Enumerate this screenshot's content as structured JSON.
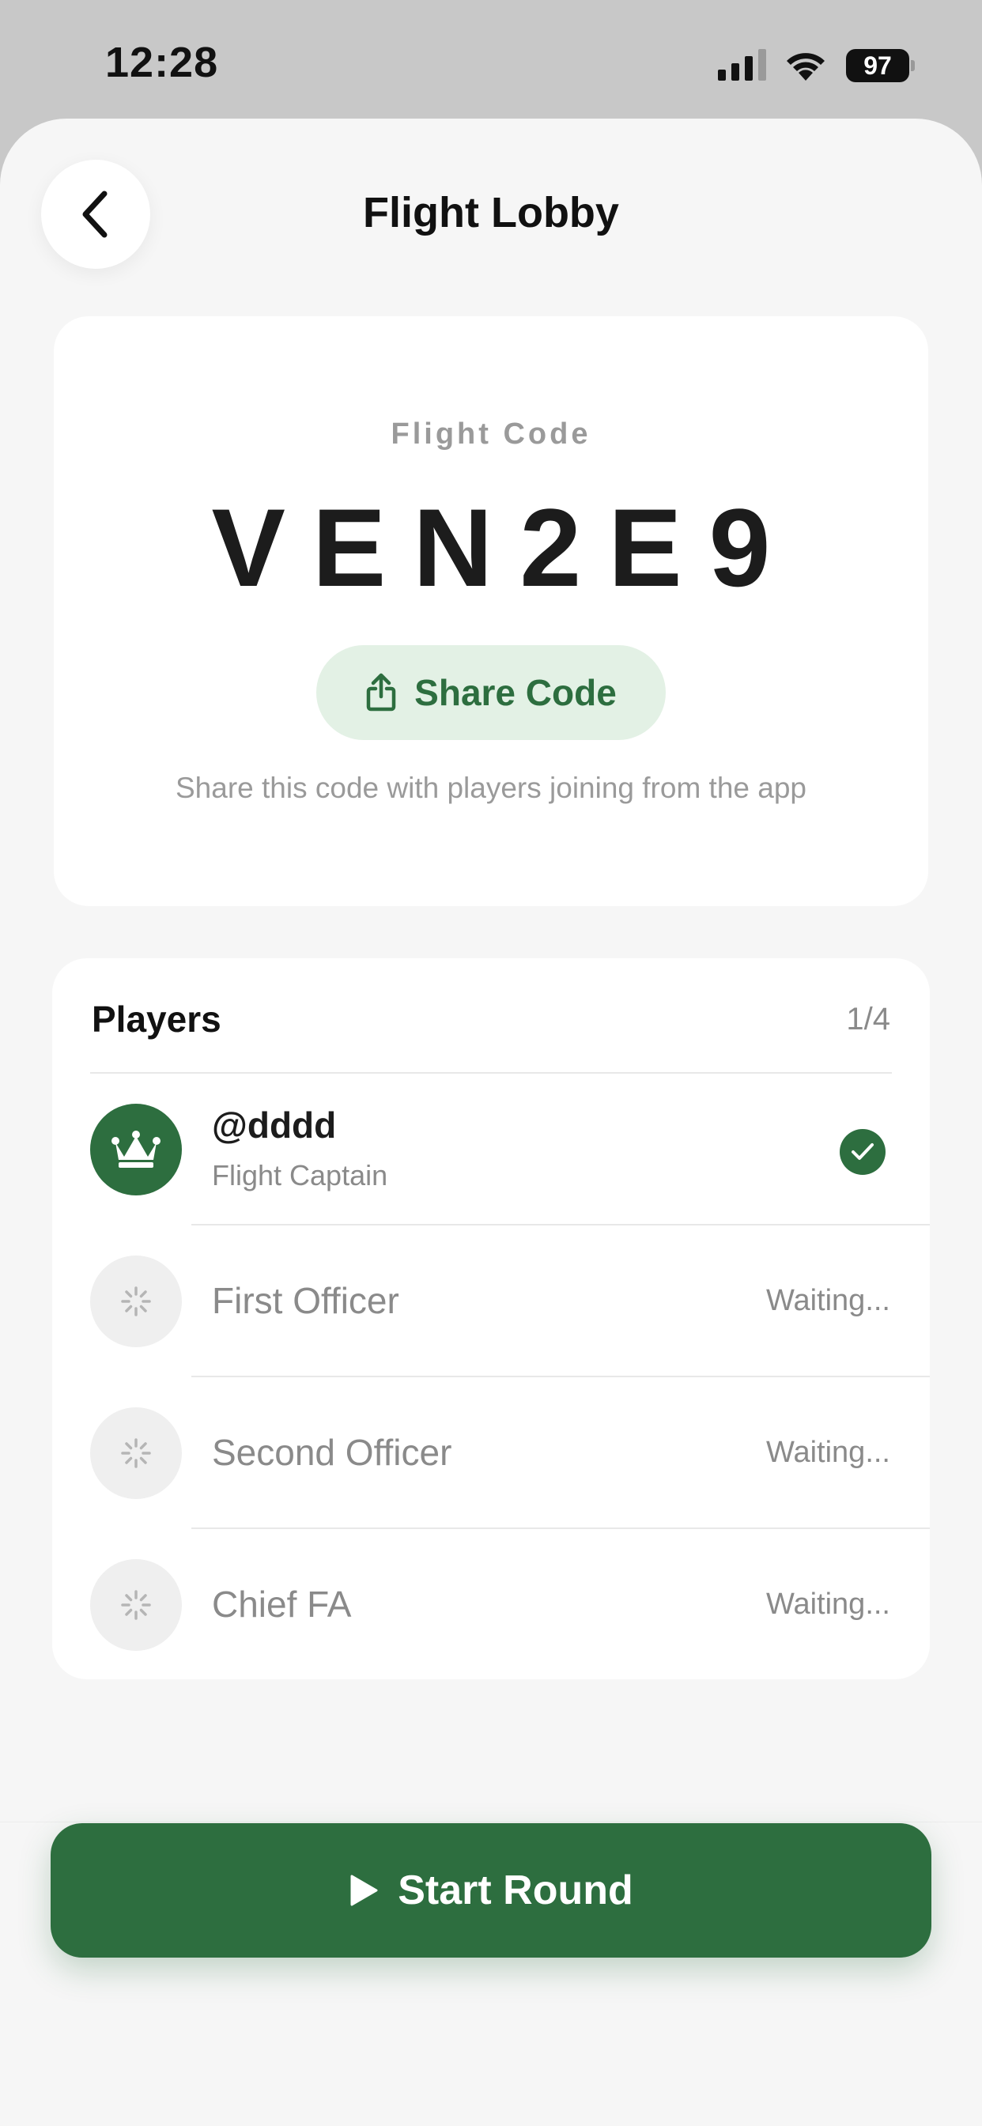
{
  "status_bar": {
    "time": "12:28",
    "battery": "97"
  },
  "header": {
    "title": "Flight Lobby",
    "back_icon": "chevron-left-icon"
  },
  "code_card": {
    "label": "Flight Code",
    "code": "VEN2E9",
    "share_label": "Share Code",
    "share_icon": "share-icon",
    "hint": "Share this code with players joining from the app"
  },
  "players": {
    "title": "Players",
    "count": "1/4",
    "rows": [
      {
        "name": "@dddd",
        "role": "Flight Captain",
        "status": "ready",
        "icon": "crown-icon"
      },
      {
        "name": "First Officer",
        "state": "Waiting...",
        "icon": "spinner-icon"
      },
      {
        "name": "Second Officer",
        "state": "Waiting...",
        "icon": "spinner-icon"
      },
      {
        "name": "Chief FA",
        "state": "Waiting...",
        "icon": "spinner-icon"
      }
    ]
  },
  "footer": {
    "start_label": "Start Round",
    "start_icon": "play-icon"
  },
  "colors": {
    "accent": "#2d6e3f",
    "accent_soft": "#e3f1e5",
    "muted": "#8a8a8a"
  }
}
